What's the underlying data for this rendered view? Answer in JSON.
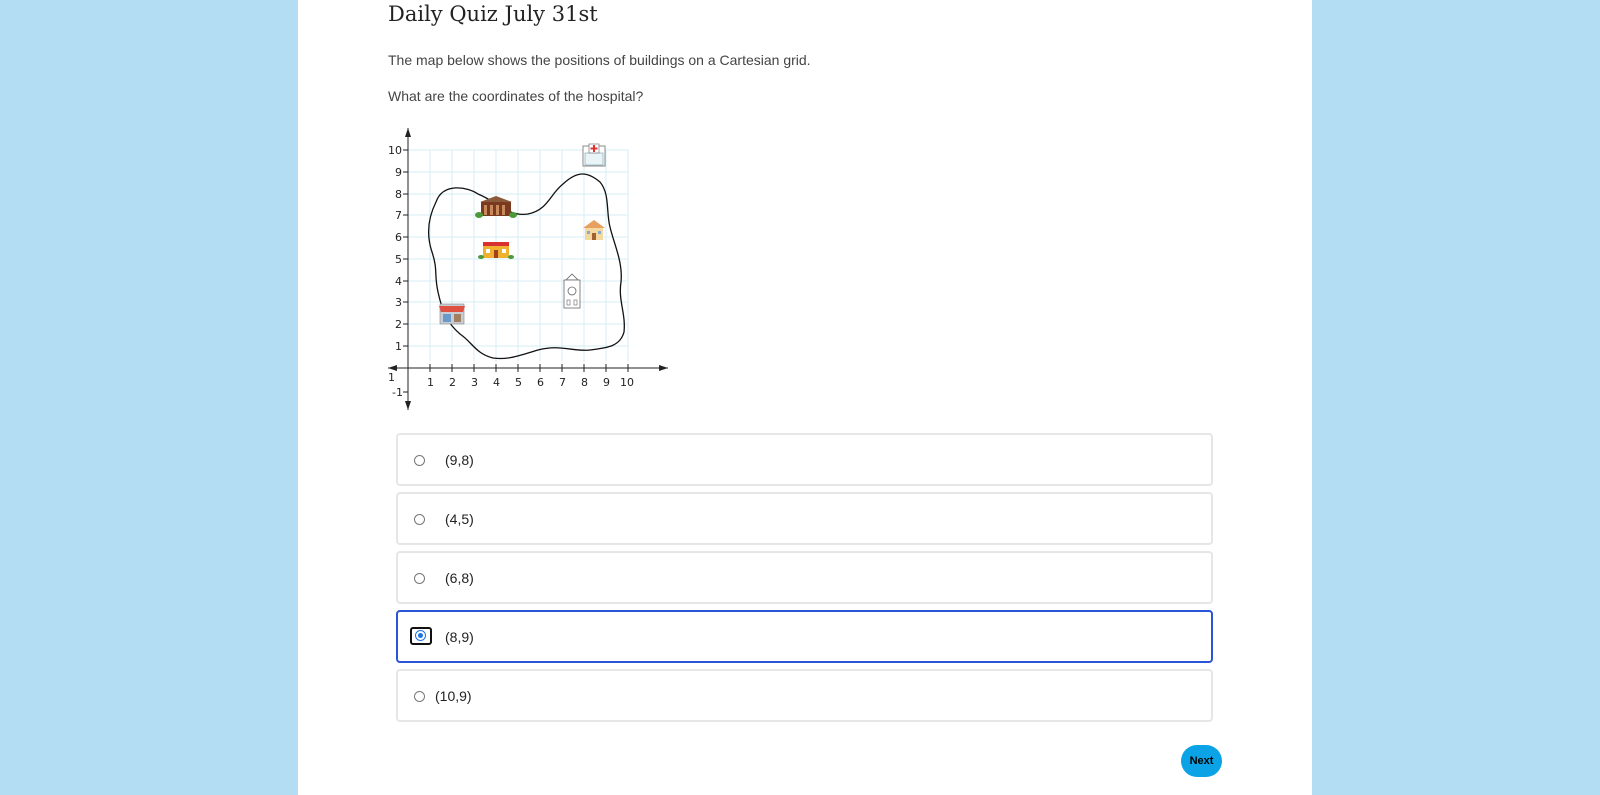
{
  "quiz": {
    "title": "Daily Quiz July 31st",
    "intro": "The map below shows the positions of buildings on a Cartesian grid.",
    "question": "What are the coordinates of the hospital?"
  },
  "map": {
    "x_ticks": [
      "-1",
      "1",
      "2",
      "3",
      "4",
      "5",
      "6",
      "7",
      "8",
      "9",
      "10"
    ],
    "y_ticks": [
      "10",
      "9",
      "8",
      "7",
      "6",
      "5",
      "4",
      "3",
      "2",
      "1",
      "-1"
    ],
    "buildings": [
      {
        "name": "hospital",
        "icon": "hospital-icon",
        "x": 8,
        "y": 9
      },
      {
        "name": "museum",
        "icon": "museum-icon",
        "x": 4,
        "y": 7
      },
      {
        "name": "house",
        "icon": "house-icon",
        "x": 8,
        "y": 6
      },
      {
        "name": "school",
        "icon": "school-icon",
        "x": 4,
        "y": 5
      },
      {
        "name": "clock tower",
        "icon": "clock-tower-icon",
        "x": 7,
        "y": 3
      },
      {
        "name": "shop",
        "icon": "shop-icon",
        "x": 2,
        "y": 2
      }
    ]
  },
  "options": [
    {
      "label": "(9,8)",
      "selected": false
    },
    {
      "label": "(4,5)",
      "selected": false
    },
    {
      "label": "(6,8)",
      "selected": false
    },
    {
      "label": "(8,9)",
      "selected": true
    },
    {
      "label": "(10,9)",
      "selected": false
    }
  ],
  "buttons": {
    "next": "Next"
  },
  "colors": {
    "background": "#b3ddf2",
    "selected_border": "#2a55d8",
    "next_button": "#0ba3e6",
    "grid": "#d6eef3"
  }
}
